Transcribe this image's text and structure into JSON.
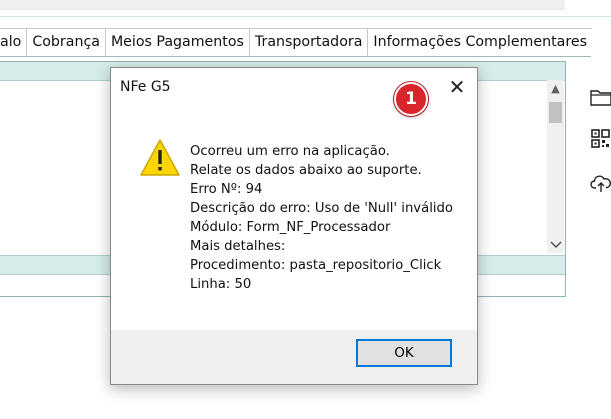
{
  "tabs": [
    {
      "label": "alo"
    },
    {
      "label": "Cobrança"
    },
    {
      "label": "Meios Pagamentos"
    },
    {
      "label": "Transportadora"
    },
    {
      "label": "Informações Complementares"
    }
  ],
  "side_toolbar": {
    "icons": [
      "folder-icon",
      "barcode-icon",
      "cloud-upload-icon"
    ]
  },
  "dialog": {
    "title": "NFe G5",
    "close_glyph": "✕",
    "badge": "1",
    "icon": "warning-icon",
    "message_lines": [
      "Ocorreu um erro na aplicação.",
      "Relate os dados abaixo ao suporte.",
      "Erro Nº: 94",
      "Descrição do erro: Uso de 'Null'  inválido",
      "Módulo: Form_NF_Processador",
      "Mais detalhes:",
      "Procedimento: pasta_repositorio_Click",
      "Linha: 50"
    ],
    "ok_label": "OK"
  },
  "colors": {
    "panel_header": "#d6ecea",
    "focus_border": "#0078d7",
    "badge": "#d9252b",
    "warning": "#ffd500"
  }
}
